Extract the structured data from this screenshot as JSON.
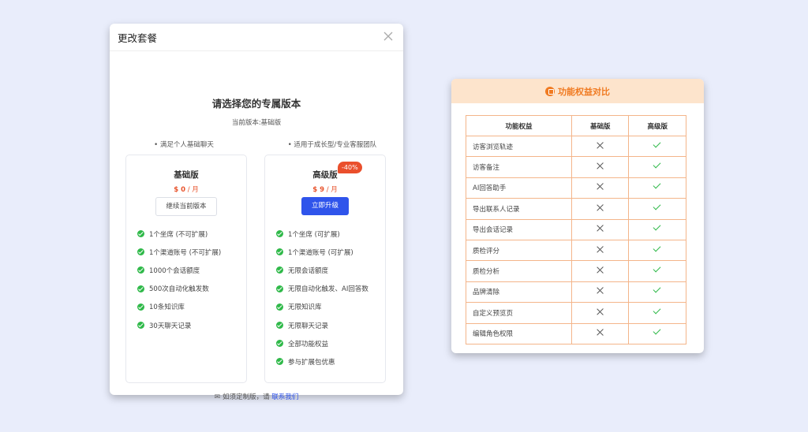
{
  "modal": {
    "title": "更改套餐",
    "heading": "请选择您的专属版本",
    "current_version": "当前版本:基础版",
    "basic": {
      "subtitle": "• 满足个人基础聊天",
      "name": "基础版",
      "price_amount": "$ 0",
      "price_unit": " / 月",
      "button": "继续当前版本",
      "features": [
        "1个坐席 (不可扩展)",
        "1个渠道账号 (不可扩展)",
        "1000个会话额度",
        "500次自动化触发数",
        "10条知识库",
        "30天聊天记录"
      ]
    },
    "advanced": {
      "subtitle": "• 适用于成长型/专业客服团队",
      "name": "高级版",
      "badge": "-40%",
      "price_amount": "$ 9",
      "price_unit": " / 月",
      "button": "立即升级",
      "features": [
        "1个坐席 (可扩展)",
        "1个渠道账号 (可扩展)",
        "无限会话额度",
        "无限自动化触发、AI回答数",
        "无限知识库",
        "无限聊天记录",
        "全部功能权益",
        "参与扩展包优惠"
      ]
    },
    "footer_text": "如须定制版，请 ",
    "footer_link": "联系我们"
  },
  "compare": {
    "title": "功能权益对比",
    "headers": [
      "功能权益",
      "基础版",
      "高级版"
    ],
    "rows": [
      {
        "feature": "访客浏览轨迹",
        "basic": false,
        "advanced": true
      },
      {
        "feature": "访客备注",
        "basic": false,
        "advanced": true
      },
      {
        "feature": "AI回答助手",
        "basic": false,
        "advanced": true
      },
      {
        "feature": "导出联系人记录",
        "basic": false,
        "advanced": true
      },
      {
        "feature": "导出会话记录",
        "basic": false,
        "advanced": true
      },
      {
        "feature": "质检评分",
        "basic": false,
        "advanced": true
      },
      {
        "feature": "质检分析",
        "basic": false,
        "advanced": true
      },
      {
        "feature": "品牌清除",
        "basic": false,
        "advanced": true
      },
      {
        "feature": "自定义预览页",
        "basic": false,
        "advanced": true
      },
      {
        "feature": "编辑角色权限",
        "basic": false,
        "advanced": true
      }
    ]
  }
}
